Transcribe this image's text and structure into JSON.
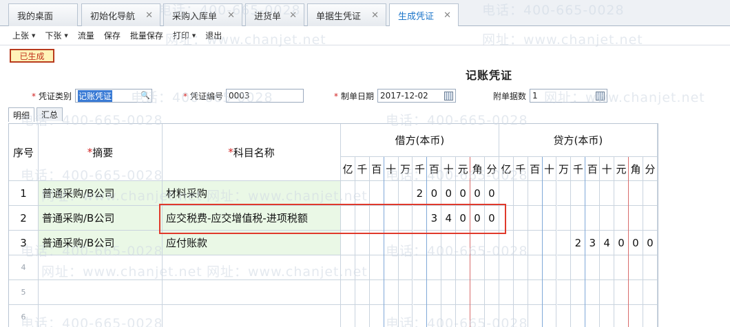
{
  "tabs": [
    {
      "label": "我的桌面",
      "closable": false
    },
    {
      "label": "初始化导航",
      "closable": true
    },
    {
      "label": "采购入库单",
      "closable": true
    },
    {
      "label": "进货单",
      "closable": true
    },
    {
      "label": "单据生凭证",
      "closable": true
    },
    {
      "label": "生成凭证",
      "closable": true,
      "active": true
    }
  ],
  "toolbar": [
    {
      "label": "上张",
      "dropdown": true
    },
    {
      "label": "下张",
      "dropdown": true
    },
    {
      "label": "流量",
      "dropdown": false
    },
    {
      "label": "保存",
      "dropdown": false
    },
    {
      "label": "批量保存",
      "dropdown": false
    },
    {
      "label": "打印",
      "dropdown": true
    },
    {
      "label": "退出",
      "dropdown": false
    }
  ],
  "status_badge": "已生成",
  "title": "记账凭证",
  "fields": {
    "voucher_type_label": "凭证类别",
    "voucher_type_value": "记账凭证",
    "voucher_no_label": "凭证编号",
    "voucher_no_value": "0003",
    "date_label": "制单日期",
    "date_value": "2017-12-02",
    "attachments_label": "附单据数",
    "attachments_value": "1"
  },
  "subtabs": [
    "明细",
    "汇总"
  ],
  "grid": {
    "col_seq": "序号",
    "col_summary": "摘要",
    "col_account": "科目名称",
    "debit_label": "借方(本币)",
    "credit_label": "贷方(本币)",
    "digit_units": [
      "亿",
      "千",
      "百",
      "十",
      "万",
      "千",
      "百",
      "十",
      "元",
      "角",
      "分"
    ],
    "rows": [
      {
        "seq": "1",
        "summary": "普通采购/B公司",
        "account": "材料采购",
        "debit": [
          "",
          "",
          "",
          "",
          "",
          "2",
          "0",
          "0",
          "0",
          "0",
          "0"
        ],
        "credit": [
          "",
          "",
          "",
          "",
          "",
          "",
          "",
          "",
          "",
          "",
          ""
        ]
      },
      {
        "seq": "2",
        "summary": "普通采购/B公司",
        "account": "应交税费-应交增值税-进项税额",
        "debit": [
          "",
          "",
          "",
          "",
          "",
          "",
          "3",
          "4",
          "0",
          "0",
          "0"
        ],
        "credit": [
          "",
          "",
          "",
          "",
          "",
          "",
          "",
          "",
          "",
          "",
          ""
        ]
      },
      {
        "seq": "3",
        "summary": "普通采购/B公司",
        "account": "应付账款",
        "debit": [
          "",
          "",
          "",
          "",
          "",
          "",
          "",
          "",
          "",
          "",
          ""
        ],
        "credit": [
          "",
          "",
          "",
          "",
          "",
          "2",
          "3",
          "4",
          "0",
          "0",
          "0"
        ]
      },
      {
        "seq": "4",
        "summary": "",
        "account": "",
        "debit": [
          "",
          "",
          "",
          "",
          "",
          "",
          "",
          "",
          "",
          "",
          ""
        ],
        "credit": [
          "",
          "",
          "",
          "",
          "",
          "",
          "",
          "",
          "",
          "",
          ""
        ]
      },
      {
        "seq": "5",
        "summary": "",
        "account": "",
        "debit": [
          "",
          "",
          "",
          "",
          "",
          "",
          "",
          "",
          "",
          "",
          ""
        ],
        "credit": [
          "",
          "",
          "",
          "",
          "",
          "",
          "",
          "",
          "",
          "",
          ""
        ]
      },
      {
        "seq": "6",
        "summary": "",
        "account": "",
        "debit": [
          "",
          "",
          "",
          "",
          "",
          "",
          "",
          "",
          "",
          "",
          ""
        ],
        "credit": [
          "",
          "",
          "",
          "",
          "",
          "",
          "",
          "",
          "",
          "",
          ""
        ]
      }
    ]
  },
  "watermarks": [
    "电话：400-665-0028",
    "网址：www.chanjet.net"
  ]
}
